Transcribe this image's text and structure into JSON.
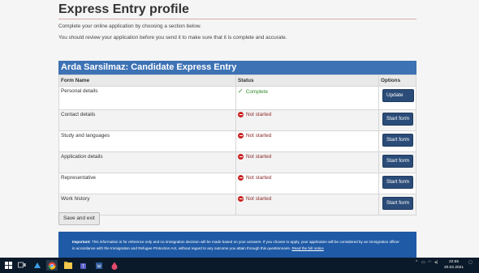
{
  "page": {
    "heading": "Express Entry profile",
    "intro_line1": "Complete your online application by choosing a section below.",
    "intro_line2": "You should review your application before you send it to make sure that it is complete and accurate."
  },
  "panel": {
    "title": "Arda Sarsilmaz: Candidate Express Entry"
  },
  "table": {
    "headers": [
      "Form Name",
      "Status",
      "Options"
    ],
    "rows": [
      {
        "name": "Personal details",
        "status": "Complete",
        "button": "Update form"
      },
      {
        "name": "Contact details",
        "status": "Not started",
        "button": "Start form"
      },
      {
        "name": "Study and languages",
        "status": "Not started",
        "button": "Start form"
      },
      {
        "name": "Application details",
        "status": "Not started",
        "button": "Start form"
      },
      {
        "name": "Representative",
        "status": "Not started",
        "button": "Start form"
      },
      {
        "name": "Work history",
        "status": "Not started",
        "button": "Start form"
      }
    ]
  },
  "actions": {
    "save_exit": "Save and exit"
  },
  "notice": {
    "label": "Important:",
    "text": "This information is for reference only and no immigration decision will be made based on your answers. If you choose to apply, your application will be considered by an immigration officer in accordance with the Immigration and Refugee Protection Act, without regard to any outcome you attain through this questionnaire.",
    "link": "Read the full notice"
  },
  "taskbar": {
    "time": "22:55",
    "date": "20.02.2021"
  },
  "colors": {
    "panel_header": "#3d72b4",
    "button": "#2b4c78",
    "complete": "#2e8b2e",
    "not_started": "#cc2222",
    "notice_bg": "#1f5aa6",
    "taskbar": "#0b1a2a"
  }
}
